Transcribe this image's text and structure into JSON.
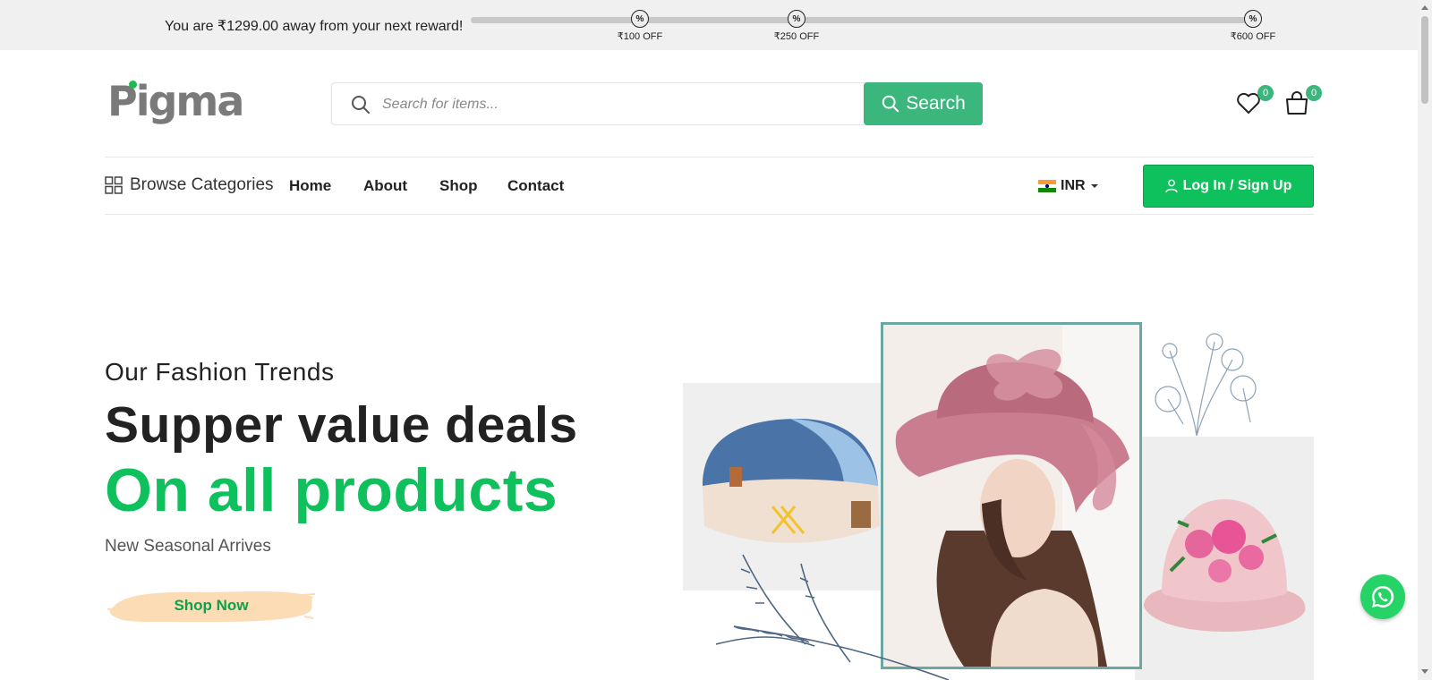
{
  "reward": {
    "message": "You are ₹1299.00 away from your next reward!",
    "progress": 0,
    "milestones": [
      {
        "symbol": "%",
        "label": "₹100 OFF"
      },
      {
        "symbol": "%",
        "label": "₹250 OFF"
      },
      {
        "symbol": "%",
        "label": "₹600 OFF"
      }
    ]
  },
  "header": {
    "logo": "Pigma",
    "search": {
      "placeholder": "Search for items...",
      "value": "",
      "button_label": "Search"
    },
    "wishlist_count": "0",
    "cart_count": "0"
  },
  "nav": {
    "browse_label": "Browse Categories",
    "items": [
      {
        "label": "Home"
      },
      {
        "label": "About"
      },
      {
        "label": "Shop"
      },
      {
        "label": "Contact"
      }
    ],
    "currency": "INR",
    "login_label": "Log In / Sign Up"
  },
  "hero": {
    "kicker": "Our Fashion Trends",
    "title": "Supper value deals",
    "title_highlight": "On all products",
    "subtitle": "New Seasonal Arrives",
    "cta_label": "Shop Now"
  },
  "colors": {
    "brand_green": "#0fc15c",
    "search_green": "#3bb77e",
    "brush_peach": "#fbdcb5",
    "frame_teal": "#6aa8a4"
  },
  "icons": [
    "search-icon",
    "heart-icon",
    "cart-icon",
    "grid-icon",
    "user-icon",
    "caret-down-icon",
    "whatsapp-icon",
    "percent-icon"
  ]
}
